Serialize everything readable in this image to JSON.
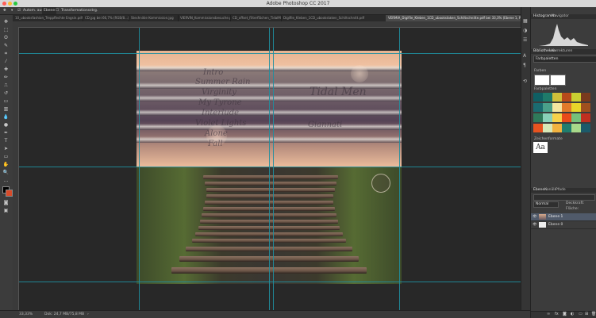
{
  "window": {
    "title": "Adobe Photoshop CC 2017"
  },
  "options_bar": {
    "auto_select": "Autom. ausw.:",
    "target": "Ebene",
    "transform": "Transformationsstrg."
  },
  "tabs": [
    "10_ubooksfashion_Treppflechte Engsin.pdf",
    "CD.jpg bei 66,7% (RGB/8...)",
    "Stechnikle Kommission.jpg",
    "VIERVIN_Kommissionsbesuche.pdf",
    "CD_offset_Filterflächen_TidalMen.pdf",
    "Digifile_Kleben_1CD_ubookstaken_Schiltschnitt.pdf",
    "VERMIA_Digifile_Kleben_1CD_ubookstaken_Schiltschnitte.pdf bei 33,3% (Ebene 1, RGB/8#)"
  ],
  "document": {
    "lyrics_left": [
      "Intro",
      "Summer Rain",
      "Virginity",
      "My Tyrone",
      "Interlude",
      "Violet Lights",
      "Alone",
      "Fall"
    ],
    "lyrics_right": [
      "Tidal Men",
      "Giannati"
    ]
  },
  "panels": {
    "histogram_tabs": [
      "Histogramm",
      "Navigator"
    ],
    "library_tabs": [
      "Bibliotheken",
      "Korrekturen"
    ],
    "library_select": "Farbpaletten",
    "colors_label": "Farben",
    "swatches_label": "Farbpaletten",
    "char_styles_label": "Zeichenformate",
    "layers_tabs": [
      "Ebenen",
      "Kanäle",
      "Pfade"
    ],
    "blend_mode": "Normal",
    "opacity_label": "Deckkraft:",
    "fill_label": "Fläche:",
    "layers": [
      "Ebene 1",
      "Ebene 0"
    ]
  },
  "swatches": [
    [
      "#0f5f63",
      "#1e7a6a",
      "#cfc03a",
      "#b84a1a",
      "#c9cf32",
      "#7a3a1d"
    ],
    [
      "#1a6b70",
      "#4aa08a",
      "#f4e6a0",
      "#e07a2a",
      "#e8d62a",
      "#a0501e"
    ],
    [
      "#2f7a5a",
      "#8ad0b8",
      "#f6d24a",
      "#e84a1a",
      "#76c07a",
      "#c03020"
    ],
    [
      "#e8531f",
      "#d8e8b8",
      "#f1b23f",
      "#1f7d6e",
      "#a8d88a",
      "#1c5a6a"
    ]
  ],
  "status": {
    "zoom": "33,33%",
    "doc": "Dok: 24,7 MB/75,8 MB"
  },
  "colors": {
    "foreground": "#000000",
    "background": "#d84b2a",
    "guide": "#1f8fa0"
  }
}
